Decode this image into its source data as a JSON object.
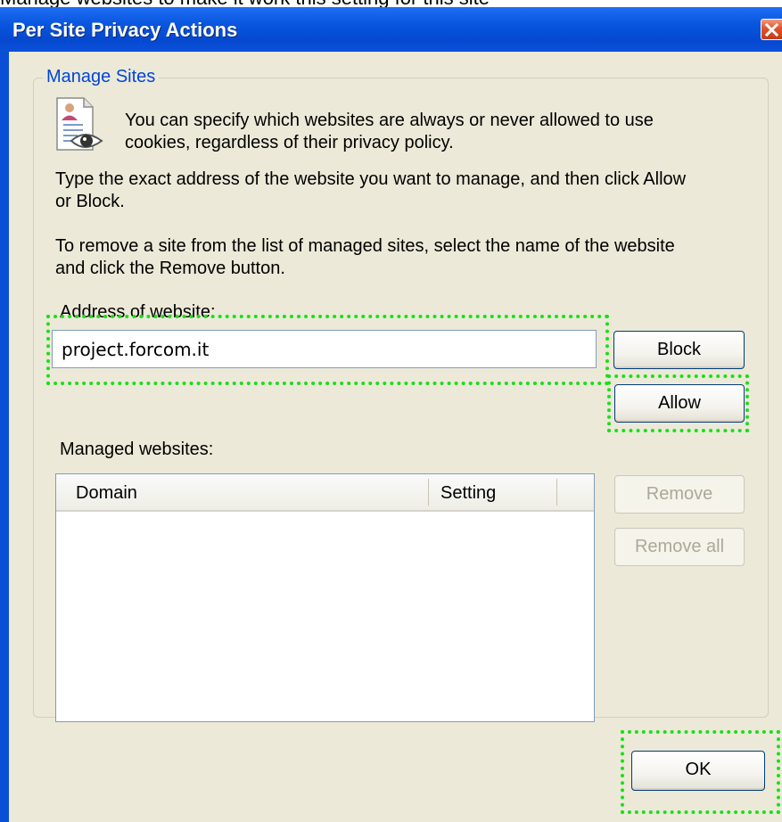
{
  "top_fragment": "Manage websites to make it work this setting for this site",
  "window": {
    "title": "Per Site Privacy Actions"
  },
  "group": {
    "title": "Manage Sites",
    "intro_line1": "You can specify which websites are always or never allowed to use",
    "intro_line2": "cookies, regardless of their privacy policy.",
    "para1_line1": "Type the exact address of the website you want to manage, and then click Allow",
    "para1_line2": "or Block.",
    "para2_line1": "To remove a site from the list of managed sites, select the name of the website",
    "para2_line2": "and click the Remove button.",
    "address_label": "Address of website:",
    "address_value": "project.forcom.it",
    "block_label": "Block",
    "allow_label": "Allow",
    "managed_label": "Managed websites:",
    "columns": [
      "Domain",
      "Setting"
    ],
    "remove_label": "Remove",
    "remove_all_label": "Remove all"
  },
  "ok_label": "OK",
  "colors": {
    "titlebar": "#0a57e0",
    "dialog_bg": "#ece9d8",
    "group_title": "#0046d5",
    "highlight": "#18e018"
  },
  "icons": [
    "document-eye-icon",
    "close-icon"
  ]
}
